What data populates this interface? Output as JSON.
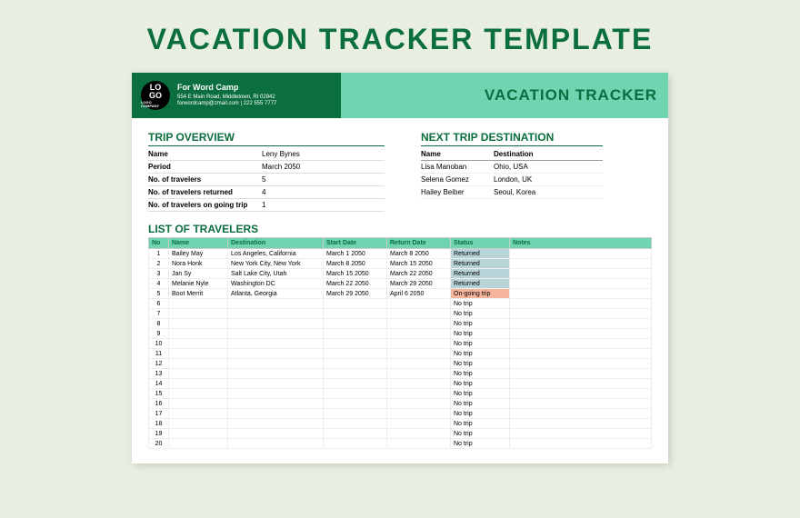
{
  "pageTitle": "VACATION TRACKER TEMPLATE",
  "header": {
    "logoTop": "LO",
    "logoMid": "GO",
    "logoSub": "LOGO COMPANY",
    "companyName": "For Word Camp",
    "address": "554 E Main Road, Middletown, RI 02842",
    "contact": "forwordcamp@zmail.com | 222 555 7777",
    "trackerTitle": "VACATION TRACKER"
  },
  "overview": {
    "title": "TRIP OVERVIEW",
    "rows": [
      {
        "label": "Name",
        "value": "Leny Bynes"
      },
      {
        "label": "Period",
        "value": "March 2050"
      },
      {
        "label": "No. of travelers",
        "value": "5"
      },
      {
        "label": "No. of travelers returned",
        "value": "4"
      },
      {
        "label": "No. of travelers on going trip",
        "value": "1"
      }
    ]
  },
  "nextTrip": {
    "title": "NEXT TRIP DESTINATION",
    "headers": {
      "name": "Name",
      "destination": "Destination"
    },
    "rows": [
      {
        "name": "Lisa Manoban",
        "destination": "Ohio, USA"
      },
      {
        "name": "Selena Gomez",
        "destination": "London, UK"
      },
      {
        "name": "Hailey Beiber",
        "destination": "Seoul, Korea"
      }
    ]
  },
  "travelers": {
    "title": "LIST OF TRAVELERS",
    "headers": {
      "no": "No",
      "name": "Name",
      "destination": "Destination",
      "startDate": "Start Date",
      "returnDate": "Return Date",
      "status": "Status",
      "notes": "Notes"
    },
    "rows": [
      {
        "no": "1",
        "name": "Bailey May",
        "destination": "Los Angeles, California",
        "startDate": "March 1 2050",
        "returnDate": "March 8 2050",
        "status": "Returned",
        "statusClass": "returned"
      },
      {
        "no": "2",
        "name": "Nora Honk",
        "destination": "New York City, New York",
        "startDate": "March 8 2050",
        "returnDate": "March 15 2050",
        "status": "Returned",
        "statusClass": "returned"
      },
      {
        "no": "3",
        "name": "Jan Sy",
        "destination": "Salt Lake City, Utah",
        "startDate": "March 15 2050",
        "returnDate": "March 22 2050",
        "status": "Returned",
        "statusClass": "returned"
      },
      {
        "no": "4",
        "name": "Melanie Nyle",
        "destination": "Washington DC",
        "startDate": "March 22 2050",
        "returnDate": "March 29 2050",
        "status": "Returned",
        "statusClass": "returned"
      },
      {
        "no": "5",
        "name": "Boot Merrit",
        "destination": "Atlanta, Georgia",
        "startDate": "March 29 2050",
        "returnDate": "April 6 2050",
        "status": "On-going trip",
        "statusClass": "ongoing"
      },
      {
        "no": "6",
        "name": "",
        "destination": "",
        "startDate": "",
        "returnDate": "",
        "status": "No trip"
      },
      {
        "no": "7",
        "name": "",
        "destination": "",
        "startDate": "",
        "returnDate": "",
        "status": "No trip"
      },
      {
        "no": "8",
        "name": "",
        "destination": "",
        "startDate": "",
        "returnDate": "",
        "status": "No trip"
      },
      {
        "no": "9",
        "name": "",
        "destination": "",
        "startDate": "",
        "returnDate": "",
        "status": "No trip"
      },
      {
        "no": "10",
        "name": "",
        "destination": "",
        "startDate": "",
        "returnDate": "",
        "status": "No trip"
      },
      {
        "no": "11",
        "name": "",
        "destination": "",
        "startDate": "",
        "returnDate": "",
        "status": "No trip"
      },
      {
        "no": "12",
        "name": "",
        "destination": "",
        "startDate": "",
        "returnDate": "",
        "status": "No trip"
      },
      {
        "no": "13",
        "name": "",
        "destination": "",
        "startDate": "",
        "returnDate": "",
        "status": "No trip"
      },
      {
        "no": "14",
        "name": "",
        "destination": "",
        "startDate": "",
        "returnDate": "",
        "status": "No trip"
      },
      {
        "no": "15",
        "name": "",
        "destination": "",
        "startDate": "",
        "returnDate": "",
        "status": "No trip"
      },
      {
        "no": "16",
        "name": "",
        "destination": "",
        "startDate": "",
        "returnDate": "",
        "status": "No trip"
      },
      {
        "no": "17",
        "name": "",
        "destination": "",
        "startDate": "",
        "returnDate": "",
        "status": "No trip"
      },
      {
        "no": "18",
        "name": "",
        "destination": "",
        "startDate": "",
        "returnDate": "",
        "status": "No trip"
      },
      {
        "no": "19",
        "name": "",
        "destination": "",
        "startDate": "",
        "returnDate": "",
        "status": "No trip"
      },
      {
        "no": "20",
        "name": "",
        "destination": "",
        "startDate": "",
        "returnDate": "",
        "status": "No trip"
      }
    ]
  }
}
